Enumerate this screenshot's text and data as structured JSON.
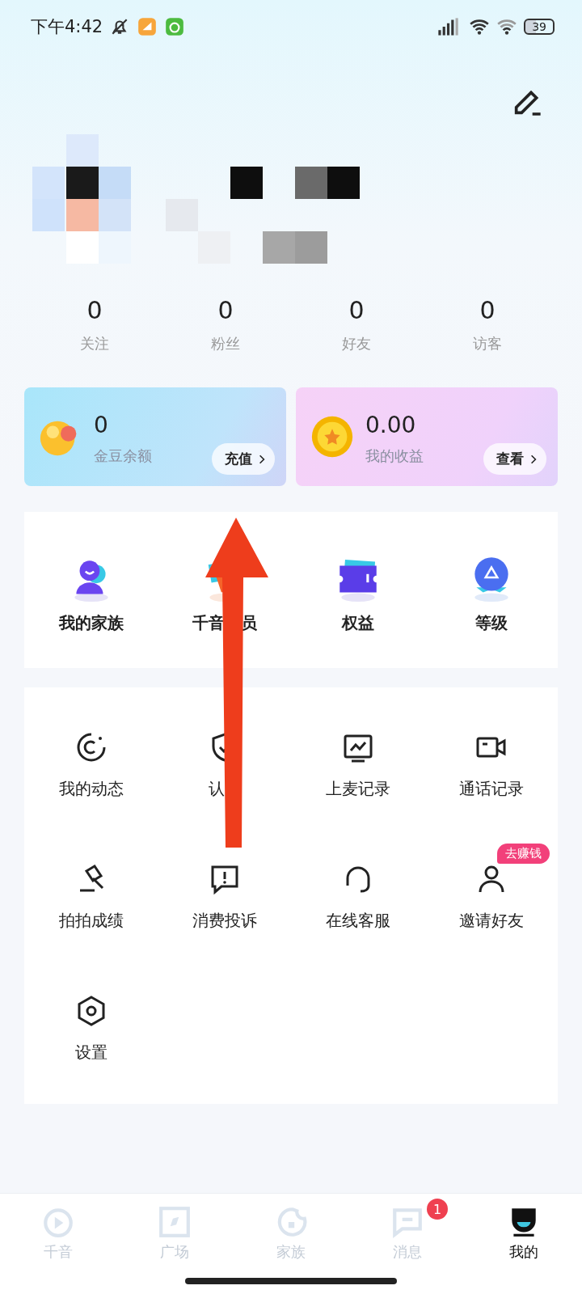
{
  "status_bar": {
    "time": "下午4:42",
    "battery": "39"
  },
  "stats": [
    {
      "value": "0",
      "label": "关注"
    },
    {
      "value": "0",
      "label": "粉丝"
    },
    {
      "value": "0",
      "label": "好友"
    },
    {
      "value": "0",
      "label": "访客"
    }
  ],
  "wallet": [
    {
      "kind": "beans",
      "value": "0",
      "label": "金豆余额",
      "button": "充值"
    },
    {
      "kind": "income",
      "value": "0.00",
      "label": "我的收益",
      "button": "查看"
    }
  ],
  "features": [
    {
      "parts": [
        {
          "kind": "text",
          "text": "我的家族"
        }
      ]
    },
    {
      "parts": [
        {
          "kind": "text",
          "text": "千音"
        },
        {
          "kind": "covered"
        },
        {
          "kind": "text",
          "text": "员"
        }
      ]
    },
    {
      "parts": [
        {
          "kind": "text",
          "text": "权益"
        }
      ]
    },
    {
      "parts": [
        {
          "kind": "text",
          "text": "等级"
        }
      ]
    }
  ],
  "tools": [
    {
      "parts": [
        {
          "kind": "text",
          "text": "我的动态"
        }
      ]
    },
    {
      "parts": [
        {
          "kind": "text",
          "text": "认"
        },
        {
          "kind": "covered"
        }
      ]
    },
    {
      "parts": [
        {
          "kind": "text",
          "text": "上麦记录"
        }
      ]
    },
    {
      "parts": [
        {
          "kind": "text",
          "text": "通话记录"
        }
      ]
    },
    {
      "parts": [
        {
          "kind": "text",
          "text": "拍拍成绩"
        }
      ]
    },
    {
      "parts": [
        {
          "kind": "text",
          "text": "消费投诉"
        }
      ]
    },
    {
      "parts": [
        {
          "kind": "text",
          "text": "在线客服"
        }
      ]
    },
    {
      "parts": [
        {
          "kind": "text",
          "text": "邀请好友"
        }
      ],
      "badge": "去赚钱"
    },
    {
      "parts": [
        {
          "kind": "text",
          "text": "设置"
        }
      ]
    }
  ],
  "nav": [
    {
      "label": "千音",
      "selected": false
    },
    {
      "label": "广场",
      "selected": false
    },
    {
      "label": "家族",
      "selected": false
    },
    {
      "label": "消息",
      "selected": false,
      "badge": "1"
    },
    {
      "label": "我的",
      "selected": true
    }
  ]
}
